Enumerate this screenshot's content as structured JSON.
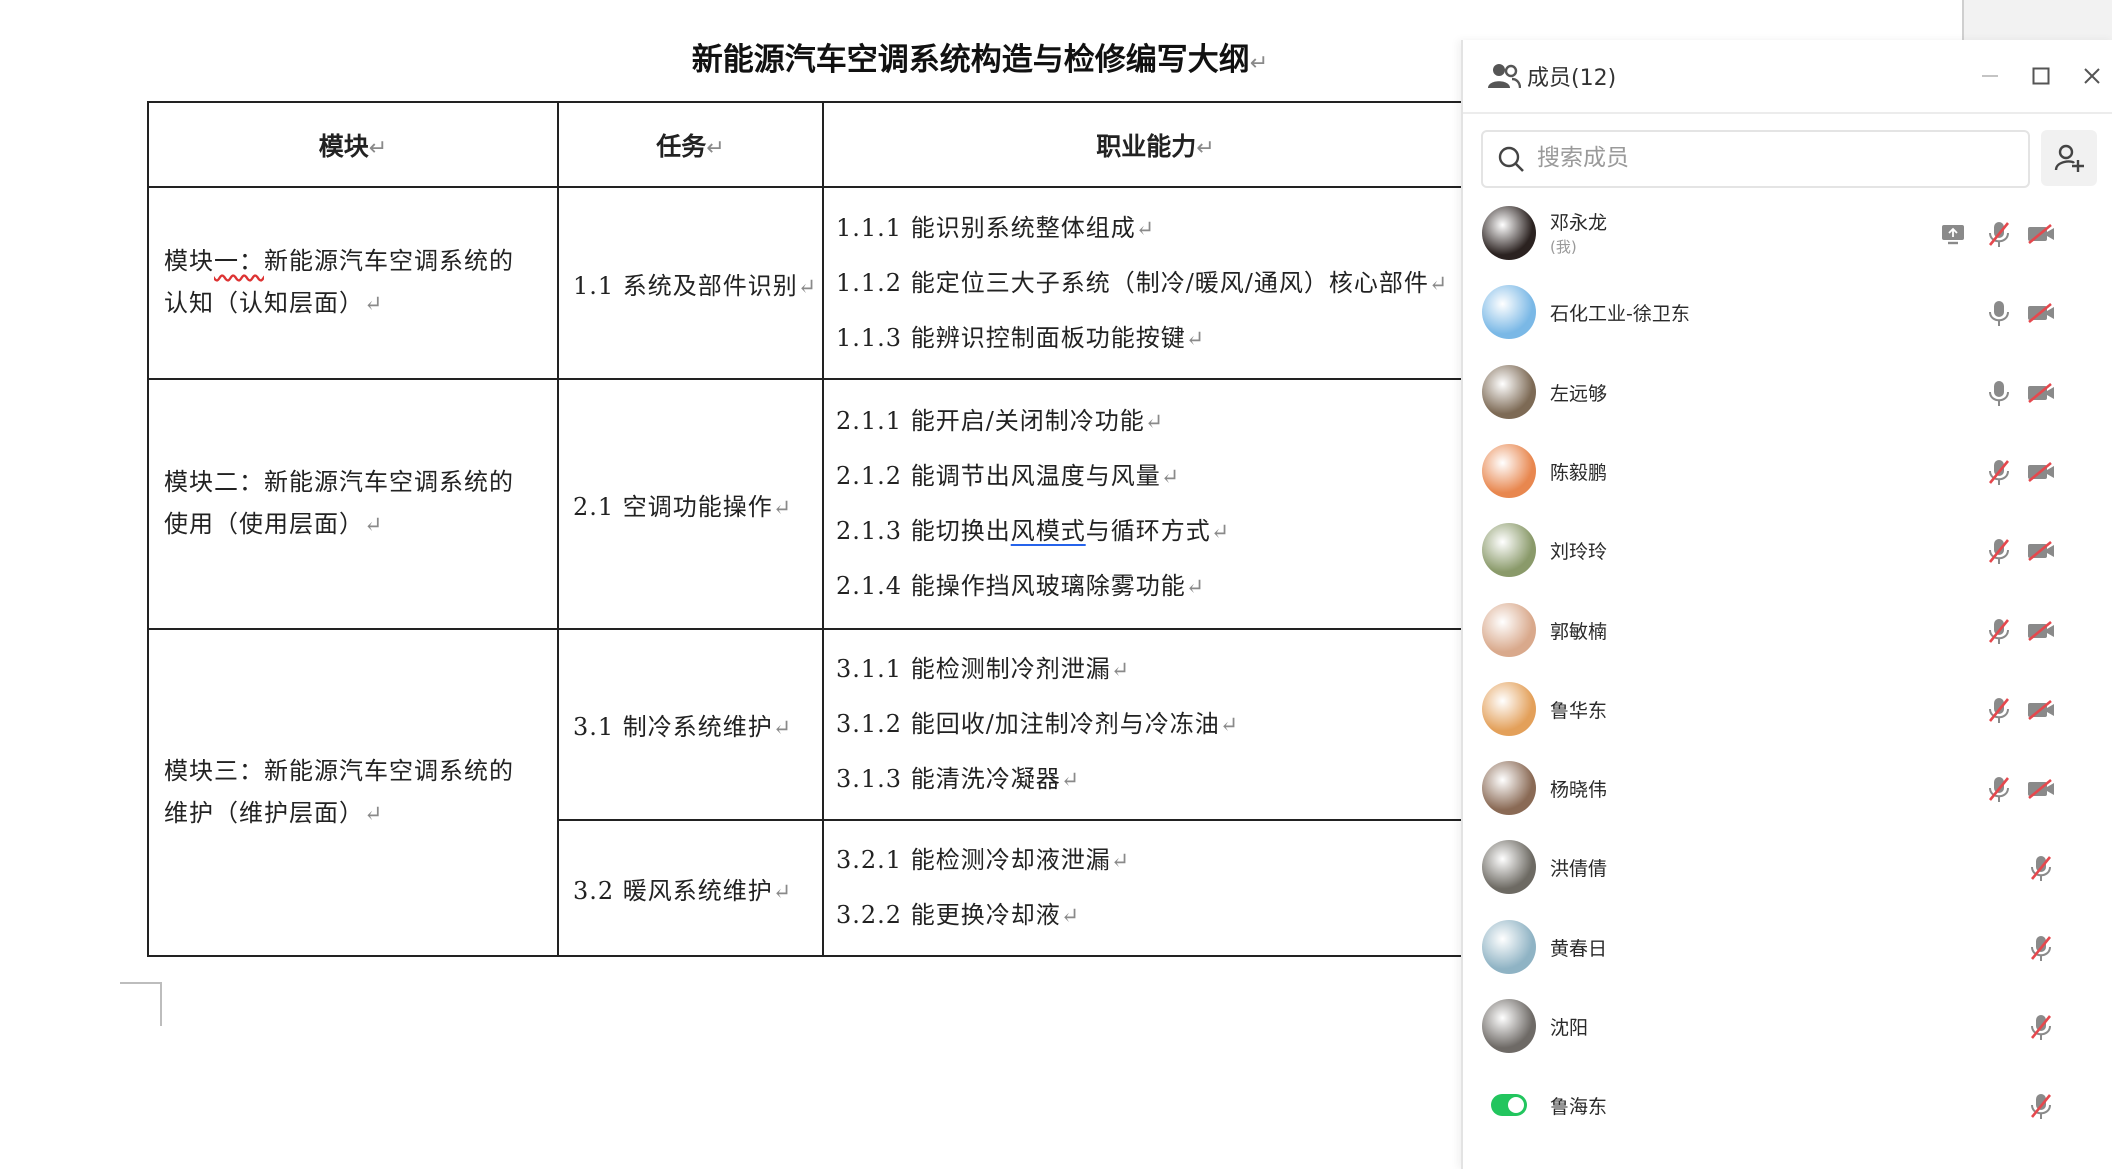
{
  "document": {
    "title": "新能源汽车空调系统构造与检修编写大纲",
    "para_mark": "↵",
    "headers": {
      "module": "模块",
      "task": "任务",
      "capability": "职业能力"
    },
    "modules": [
      {
        "name_line1_prefix": "模块",
        "name_line1_underlined": "一：",
        "name_line1_rest": "新能源汽车空调系统的",
        "name_line2": "认知（认知层面）",
        "tasks": [
          {
            "label": "1.1  系统及部件识别",
            "capabilities": [
              "1.1.1 能识别系统整体组成",
              "1.1.2 能定位三大子系统（制冷/暖风/通风）核心部件",
              "1.1.3 能辨识控制面板功能按键"
            ]
          }
        ]
      },
      {
        "name_line1": "模块二：新能源汽车空调系统的",
        "name_line2": "使用（使用层面）",
        "tasks": [
          {
            "label": "2.1  空调功能操作",
            "capabilities": [
              "2.1.1 能开启/关闭制冷功能",
              "2.1.2 能调节出风温度与风量",
              {
                "before": "2.1.3 能切换出",
                "underlined": "风模式",
                "after": "与循环方式"
              },
              "2.1.4 能操作挡风玻璃除雾功能"
            ]
          }
        ]
      },
      {
        "name_line1": "模块三：新能源汽车空调系统的",
        "name_line2": "维护（维护层面）",
        "tasks": [
          {
            "label": "3.1  制冷系统维护",
            "capabilities": [
              "3.1.1 能检测制冷剂泄漏",
              "3.1.2 能回收/加注制冷剂与冷冻油",
              "3.1.3 能清洗冷凝器"
            ]
          },
          {
            "label": "3.2  暖风系统维护",
            "capabilities": [
              "3.2.1 能检测冷却液泄漏",
              "3.2.2 能更换冷却液"
            ]
          }
        ]
      }
    ]
  },
  "members_panel": {
    "title": "成员(12)",
    "search_placeholder": "搜索成员",
    "members": [
      {
        "name": "邓永龙",
        "sub": "(我)",
        "avatar_color": "#2b2220",
        "icons": [
          "screen-share",
          "mic-off",
          "video-off"
        ]
      },
      {
        "name": "石化工业-徐卫东",
        "avatar_color": "#7ab8e6",
        "icons": [
          "mic-on",
          "video-off"
        ]
      },
      {
        "name": "左远够",
        "avatar_color": "#7d6a55",
        "icons": [
          "mic-on",
          "video-off"
        ]
      },
      {
        "name": "陈毅鹏",
        "avatar_color": "#e8874f",
        "icons": [
          "mic-off",
          "video-off"
        ]
      },
      {
        "name": "刘玲玲",
        "avatar_color": "#8a9a6a",
        "icons": [
          "mic-off",
          "video-off"
        ]
      },
      {
        "name": "郭敏楠",
        "avatar_color": "#d9a98c",
        "icons": [
          "mic-off",
          "video-off"
        ]
      },
      {
        "name": "鲁华东",
        "avatar_color": "#e3a05a",
        "icons": [
          "mic-off",
          "video-off"
        ]
      },
      {
        "name": "杨晓伟",
        "avatar_color": "#8a6a55",
        "icons": [
          "mic-off",
          "video-off"
        ]
      },
      {
        "name": "洪倩倩",
        "avatar_color": "#6d6a63",
        "icons": [
          "mic-off"
        ]
      },
      {
        "name": "黄春日",
        "avatar_color": "#8fb3c4",
        "icons": [
          "mic-off"
        ]
      },
      {
        "name": "沈阳",
        "avatar_color": "#6e6a66",
        "icons": [
          "mic-off"
        ]
      },
      {
        "name": "鲁海东",
        "avatar_type": "toggle",
        "icons": [
          "mic-off"
        ]
      }
    ]
  },
  "colors": {
    "accent_red": "#e5484d",
    "icon_gray": "#8a8a8a",
    "toggle_green": "#22c55e"
  }
}
